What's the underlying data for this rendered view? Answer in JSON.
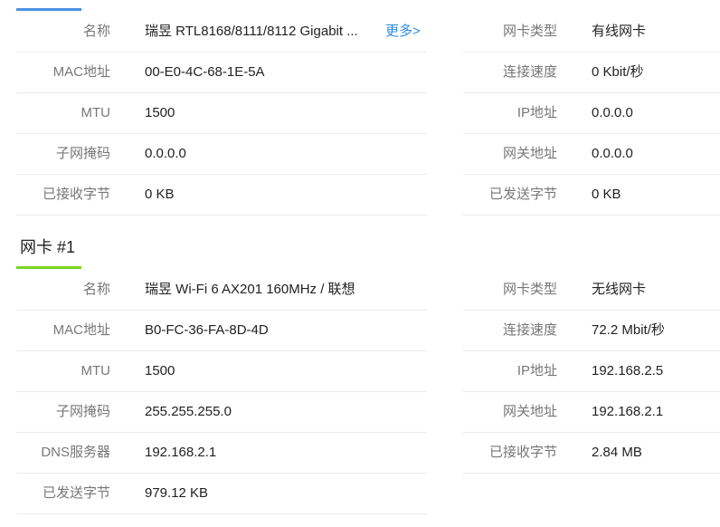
{
  "colors": {
    "tab_underline_top": "#4a90e2",
    "tab_underline_active": "#7ed321",
    "link": "#2e8ae6"
  },
  "section0": {
    "left_rows": [
      {
        "label": "名称",
        "value": "瑞昱 RTL8168/8111/8112 Gigabit ...",
        "link": "更多>"
      },
      {
        "label": "MAC地址",
        "value": "00-E0-4C-68-1E-5A"
      },
      {
        "label": "MTU",
        "value": "1500"
      },
      {
        "label": "子网掩码",
        "value": "0.0.0.0"
      },
      {
        "label": "已接收字节",
        "value": "0 KB"
      }
    ],
    "right_rows": [
      {
        "label": "网卡类型",
        "value": "有线网卡"
      },
      {
        "label": "连接速度",
        "value": "0 Kbit/秒"
      },
      {
        "label": "IP地址",
        "value": "0.0.0.0"
      },
      {
        "label": "网关地址",
        "value": "0.0.0.0"
      },
      {
        "label": "已发送字节",
        "value": "0 KB"
      }
    ]
  },
  "section1": {
    "title": "网卡 #1",
    "left_rows": [
      {
        "label": "名称",
        "value": "瑞昱 Wi-Fi 6 AX201 160MHz / 联想"
      },
      {
        "label": "MAC地址",
        "value": "B0-FC-36-FA-8D-4D"
      },
      {
        "label": "MTU",
        "value": "1500"
      },
      {
        "label": "子网掩码",
        "value": "255.255.255.0"
      },
      {
        "label": "DNS服务器",
        "value": "192.168.2.1"
      },
      {
        "label": "已发送字节",
        "value": "979.12 KB"
      }
    ],
    "right_rows": [
      {
        "label": "网卡类型",
        "value": "无线网卡"
      },
      {
        "label": "连接速度",
        "value": "72.2 Mbit/秒"
      },
      {
        "label": "IP地址",
        "value": "192.168.2.5"
      },
      {
        "label": "网关地址",
        "value": "192.168.2.1"
      },
      {
        "label": "已接收字节",
        "value": "2.84 MB"
      }
    ]
  }
}
